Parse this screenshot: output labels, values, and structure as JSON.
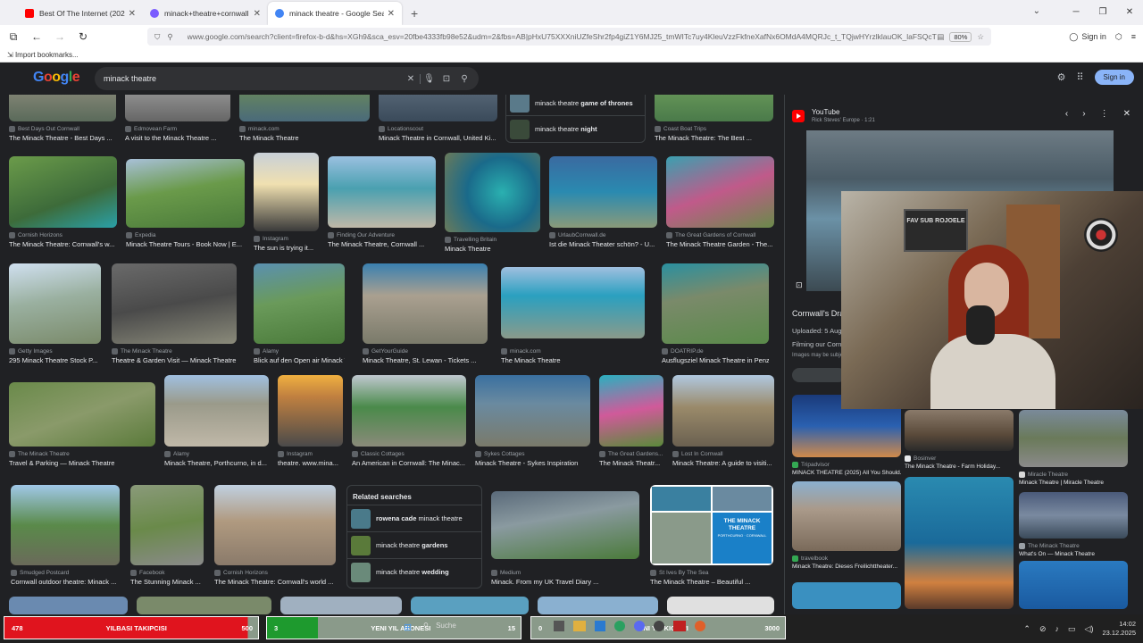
{
  "tabs": [
    {
      "label": "Best Of The Internet (2025) - Yo",
      "favicon_color": "#ff0000",
      "active": false
    },
    {
      "label": "minack+theatre+cornwall - Sur",
      "favicon_color": "#7a5cff",
      "active": false
    },
    {
      "label": "minack theatre - Google Search",
      "favicon_color": "#4285f4",
      "active": true
    }
  ],
  "navbar": {
    "url": "www.google.com/search?client=firefox-b-d&hs=XGh9&sca_esv=20fbe4333fb98e52&udm=2&fbs=AB|pHxU75XXXniUZfeShr2fp4giZ1Y6MJ25_tmWITc7uy4KleuVzzFkfneXafNx6OMdA4MQRJc_t_TQjwHYrzlklauOK_laFSQcTi",
    "zoom": "80%",
    "signin": "Sign in"
  },
  "bookmarks": {
    "import_label": "Import bookmarks..."
  },
  "google": {
    "query": "minack theatre",
    "signin": "Sign in"
  },
  "grid": {
    "row0": [
      {
        "source": "Best Days Out Cornwall",
        "title": "The Minack Theatre - Best Days ..."
      },
      {
        "source": "Edmovean Farm",
        "title": "A visit to the Minack Theatre ..."
      },
      {
        "source": "minack.com",
        "title": "The Minack Theatre"
      },
      {
        "source": "Locationscout",
        "title": "Minack Theatre in Cornwall, United Ki..."
      },
      {
        "source": "Coast Boat Trips",
        "title": "The Minack Theatre: The Best ..."
      }
    ],
    "suggestions_top": [
      {
        "prefix": "minack theatre",
        "bold": "game of thrones"
      },
      {
        "prefix": "minack theatre",
        "bold": "night"
      }
    ],
    "row1": [
      {
        "source": "Cornish Horizons",
        "title": "The Minack Theatre: Cornwall's w..."
      },
      {
        "source": "Expedia",
        "title": "Minack Theatre Tours - Book Now | E..."
      },
      {
        "source": "Instagram",
        "title": "The sun is trying it..."
      },
      {
        "source": "Finding Our Adventure",
        "title": "The Minack Theatre, Cornwall ..."
      },
      {
        "source": "Travelling Britain",
        "title": "Minack Theatre"
      },
      {
        "source": "UrlaubCornwall.de",
        "title": "Ist die Minack Theater schön? - U..."
      },
      {
        "source": "The Great Gardens of Cornwall",
        "title": "The Minack Theatre Garden - The..."
      }
    ],
    "row2": [
      {
        "source": "Getty Images",
        "title": "295 Minack Theatre Stock P..."
      },
      {
        "source": "The Minack Theatre",
        "title": "Theatre & Garden Visit — Minack Theatre"
      },
      {
        "source": "Alamy",
        "title": "Blick auf den Open air Minack T..."
      },
      {
        "source": "GetYourGuide",
        "title": "Minack Theatre, St. Lewan - Tickets ..."
      },
      {
        "source": "minack.com",
        "title": "The Minack Theatre"
      },
      {
        "source": "DOATRIP.de",
        "title": "Ausflugsziel Minack Theatre in Penza..."
      }
    ],
    "row3": [
      {
        "source": "The Minack Theatre",
        "title": "Travel & Parking — Minack Theatre"
      },
      {
        "source": "Alamy",
        "title": "Minack Theatre, Porthcurno, in d..."
      },
      {
        "source": "Instagram",
        "title": "theatre. www.mina..."
      },
      {
        "source": "Classic Cottages",
        "title": "An American in Cornwall: The Minac..."
      },
      {
        "source": "Sykes Cottages",
        "title": "Minack Theatre - Sykes Inspiration"
      },
      {
        "source": "The Great Gardens...",
        "title": "The Minack Theatr..."
      },
      {
        "source": "Lost In Cornwall",
        "title": "Minack Theatre: A guide to visiti..."
      }
    ],
    "row4": [
      {
        "source": "Smudged Postcard",
        "title": "Cornwall outdoor theatre: Minack ..."
      },
      {
        "source": "Facebook",
        "title": "The Stunning Minack ..."
      },
      {
        "source": "Cornish Horizons",
        "title": "The Minack Theatre: Cornwall's world ..."
      },
      {
        "source": "Medium",
        "title": "Minack. From my UK Travel Diary ..."
      },
      {
        "source": "St Ives By The Sea",
        "title": "The Minack Theatre – Beautiful ..."
      }
    ],
    "collage_text": "THE MINACK THEATRE",
    "collage_sub": "PORTHCURNO · CORNWALL",
    "related": {
      "heading": "Related searches",
      "items": [
        {
          "bold": "rowena cade",
          "suffix": " minack theatre"
        },
        {
          "prefix": "minack theatre ",
          "bold": "gardens"
        },
        {
          "prefix": "minack theatre ",
          "bold": "wedding"
        }
      ]
    }
  },
  "panel": {
    "channel": "YouTube",
    "meta": "Rick Steves' Europe · 1:21",
    "video_title": "Cornwall's Dra",
    "uploaded": "Uploaded: 5 Aug 2",
    "desc": "Filming our Cornw",
    "note": "Images may be subje",
    "cards": [
      {
        "source": "Tripadvisor",
        "title": "MINACK THEATRE (2025) All You Should..."
      },
      {
        "source": "Bosinver",
        "title": "The Minack Theatre - Farm Holiday..."
      },
      {
        "source": "Miracle Theatre",
        "title": "Minack Theatre | Miracle Theatre"
      },
      {
        "source": "travelbook",
        "title": "Minack Theatre: Dieses Freilichttheater..."
      },
      {
        "source": "The Minack Theatre",
        "title": "What's On — Minack Theatre"
      }
    ]
  },
  "webcam": {
    "frame_text": "FAV SUB ROJOELE"
  },
  "taskbar": {
    "alerts": [
      {
        "count": "478",
        "label": "YILBASI TAKIPCISI",
        "goal": "500",
        "fill": 0.956,
        "color": "#e0141e"
      },
      {
        "count": "3",
        "label": "YENI YIL ABONESI",
        "goal": "15",
        "fill": 0.2,
        "color": "#1e9a2e"
      },
      {
        "count": "0",
        "label": "YENI YIL KICKS'I",
        "goal": "3000",
        "fill": 0.0,
        "color": "#1e9a2e"
      }
    ],
    "search": "Suche",
    "time": "14:02",
    "date": "23.12.2025"
  }
}
